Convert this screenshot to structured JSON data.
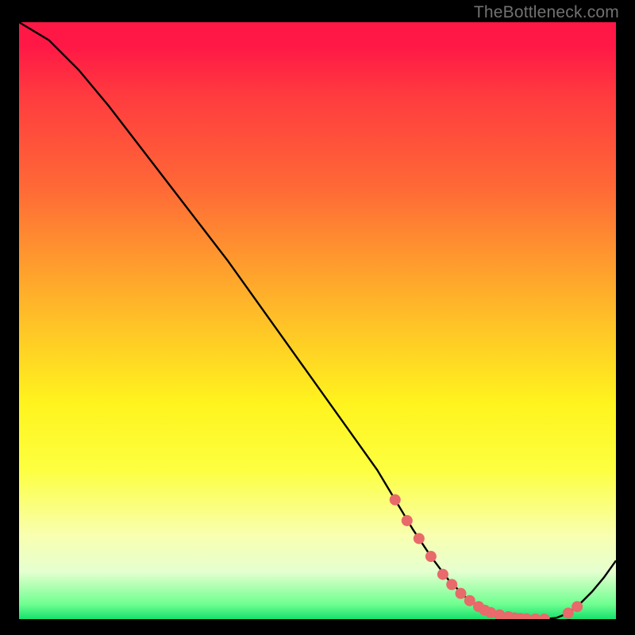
{
  "watermark": "TheBottleneck.com",
  "colors": {
    "curve": "#000000",
    "marker_fill": "#e86a6a",
    "marker_stroke": "#b94c4c",
    "gradient_top": "#ff1846",
    "gradient_mid": "#fff41e",
    "gradient_bottom": "#16e06c"
  },
  "chart_data": {
    "type": "line",
    "title": "",
    "xlabel": "",
    "ylabel": "",
    "xlim": [
      0,
      100
    ],
    "ylim": [
      0,
      100
    ],
    "x": [
      0,
      5,
      10,
      15,
      20,
      25,
      30,
      35,
      40,
      45,
      50,
      55,
      60,
      63,
      66,
      69,
      72,
      75,
      78,
      81,
      84,
      86,
      88,
      90,
      92,
      94,
      96,
      98,
      100
    ],
    "values": [
      100,
      97,
      92,
      86,
      79.5,
      73,
      66.5,
      60,
      53,
      46,
      39,
      32,
      25,
      20,
      15,
      10.5,
      6.5,
      3.5,
      1.5,
      0.5,
      0,
      0,
      0,
      0.2,
      1,
      2.6,
      4.6,
      7,
      9.8
    ],
    "markers_x": [
      63,
      65,
      67,
      69,
      71,
      72.5,
      74,
      75.5,
      77,
      78,
      79,
      80.5,
      82,
      83,
      84,
      85,
      86.5,
      88,
      92,
      93.5
    ],
    "markers_y": [
      20,
      16.5,
      13.5,
      10.5,
      7.5,
      5.8,
      4.3,
      3.1,
      2.1,
      1.5,
      1.1,
      0.7,
      0.4,
      0.2,
      0.1,
      0.05,
      0.02,
      0.0,
      1.0,
      2.1
    ]
  }
}
